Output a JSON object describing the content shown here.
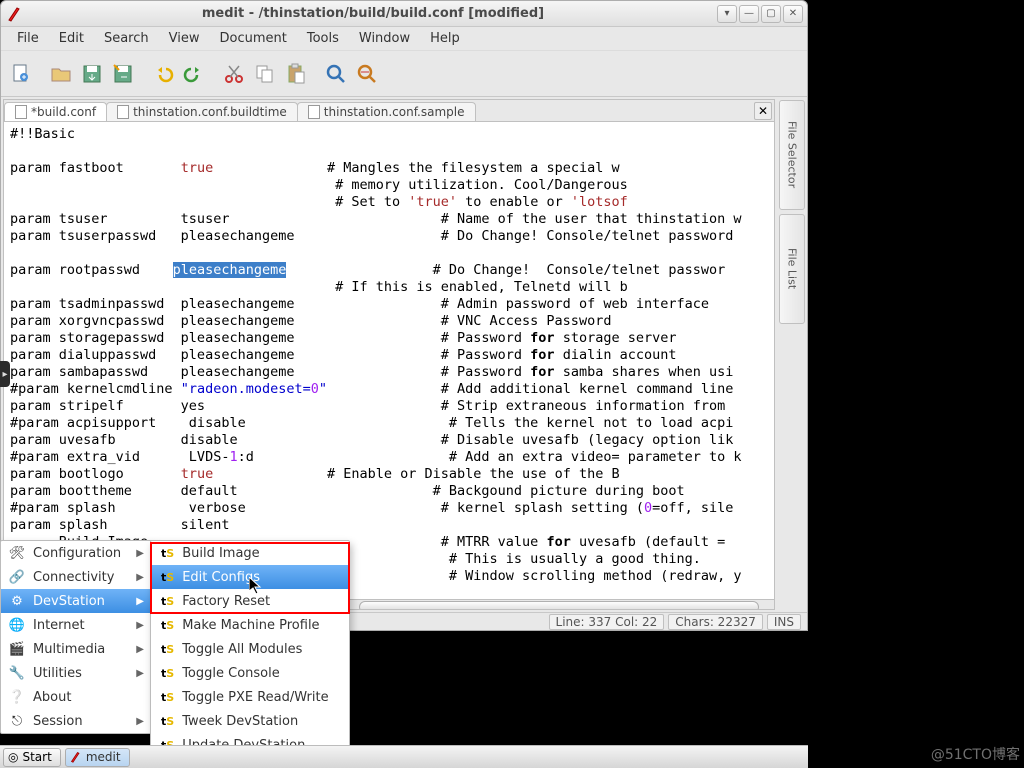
{
  "window": {
    "title": "medit - /thinstation/build/build.conf [modified]"
  },
  "menubar": [
    "File",
    "Edit",
    "Search",
    "View",
    "Document",
    "Tools",
    "Window",
    "Help"
  ],
  "tabs": [
    {
      "label": "*build.conf",
      "active": true
    },
    {
      "label": "thinstation.conf.buildtime",
      "active": false
    },
    {
      "label": "thinstation.conf.sample",
      "active": false
    }
  ],
  "sidepanels": [
    "File Selector",
    "File List"
  ],
  "status": {
    "line": "Line: 337 Col: 22",
    "chars": "Chars: 22327",
    "mode": "INS"
  },
  "code": {
    "l1": "#!!Basic",
    "l3a": "param fastboot       ",
    "l3b": "true",
    "l3c": "              # Mangles the filesystem a special w",
    "l4": "                                        # memory utilization. Cool/Dangerous",
    "l5a": "                                        # Set to ",
    "l5b": "'true'",
    "l5c": " to enable or ",
    "l5d": "'lotsof",
    "l6": "param tsuser         tsuser                          # Name of the user that thinstation w",
    "l7": "param tsuserpasswd   pleasechangeme                  # Do Change! Console/telnet password",
    "l9a": "param rootpasswd    ",
    "l9b": "pleasechangeme",
    "l9c": "                  # Do Change!  Console/telnet passwor",
    "l10": "                                        # If this is enabled, Telnetd will b",
    "l11": "param tsadminpasswd  pleasechangeme                  # Admin password of web interface",
    "l12": "param xorgvncpasswd  pleasechangeme                  # VNC Access Password",
    "l13a": "param storagepasswd  pleasechangeme                  # Password ",
    "l13b": "for",
    "l13c": " storage server",
    "l14a": "param dialuppasswd   pleasechangeme                  # Password ",
    "l14b": "for",
    "l14c": " dialin account",
    "l15a": "param sambapasswd    pleasechangeme                  # Password ",
    "l15b": "for",
    "l15c": " samba shares when usi",
    "l16a": "#param kernelcmdline ",
    "l16b": "\"radeon.modeset=",
    "l16c": "0",
    "l16d": "\"",
    "l16e": "              # Add additional kernel command line",
    "l17": "param stripelf       yes                             # Strip extraneous information from ",
    "l18": "#param acpisupport    disable                         # Tells the kernel not to load acpi",
    "l19": "param uvesafb        disable                         # Disable uvesafb (legacy option lik",
    "l20a": "#param extra_vid      LVDS-",
    "l20b": "1",
    "l20c": ":d                        # Add an extra video= parameter to k",
    "l21a": "param bootlogo       ",
    "l21b": "true",
    "l21c": "              # Enable or Disable the use of the B",
    "l22": "param boottheme      default                        # Backgound picture during boot",
    "l23a": "#param splash         verbose                        # kernel splash setting (",
    "l23b": "0",
    "l23c": "=off, sile",
    "l24": "param splash         silent",
    "l25a": "      Build Image                                    # MTRR value ",
    "l25b": "for",
    "l25c": " uvesafb (default = ",
    "l26": "                                                      # This is usually a good thing.",
    "l27": "                                                      # Window scrolling method (redraw, y"
  },
  "appmenu": [
    {
      "icon": "tools",
      "label": "Configuration"
    },
    {
      "icon": "net",
      "label": "Connectivity"
    },
    {
      "icon": "gear",
      "label": "DevStation",
      "selected": true
    },
    {
      "icon": "globe",
      "label": "Internet"
    },
    {
      "icon": "media",
      "label": "Multimedia"
    },
    {
      "icon": "util",
      "label": "Utilities"
    },
    {
      "icon": "about",
      "label": "About"
    },
    {
      "icon": "session",
      "label": "Session"
    }
  ],
  "submenu": [
    "Build Image",
    "Edit Configs",
    "Factory Reset",
    "Make Machine Profile",
    "Toggle All Modules",
    "Toggle Console",
    "Toggle PXE Read/Write",
    "Tweek DevStation",
    "Update DevStation"
  ],
  "taskbar": {
    "start": "Start",
    "task1": "medit"
  },
  "watermark": "@51CTO博客"
}
